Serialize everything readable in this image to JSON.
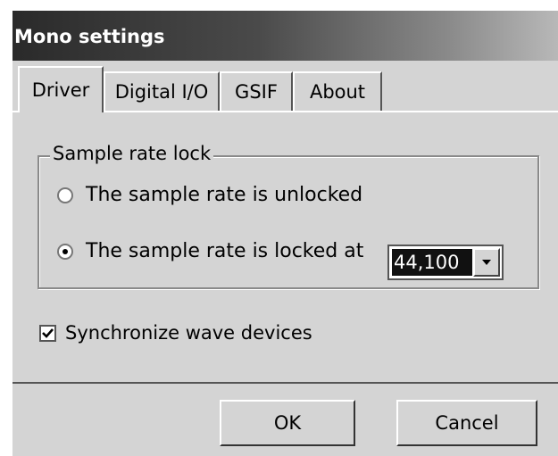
{
  "window": {
    "title": "Mono settings"
  },
  "tabs": [
    {
      "label": "Driver",
      "active": true
    },
    {
      "label": "Digital I/O",
      "active": false
    },
    {
      "label": "GSIF",
      "active": false
    },
    {
      "label": "About",
      "active": false
    }
  ],
  "sample_rate_lock": {
    "legend": "Sample rate lock",
    "option_unlocked": "The sample rate is unlocked",
    "option_locked": "The sample rate is locked at",
    "selected": "locked",
    "rate_value": "44,100"
  },
  "sync_wave": {
    "label": "Synchronize wave devices",
    "checked": true
  },
  "buttons": {
    "ok": "OK",
    "cancel": "Cancel"
  }
}
